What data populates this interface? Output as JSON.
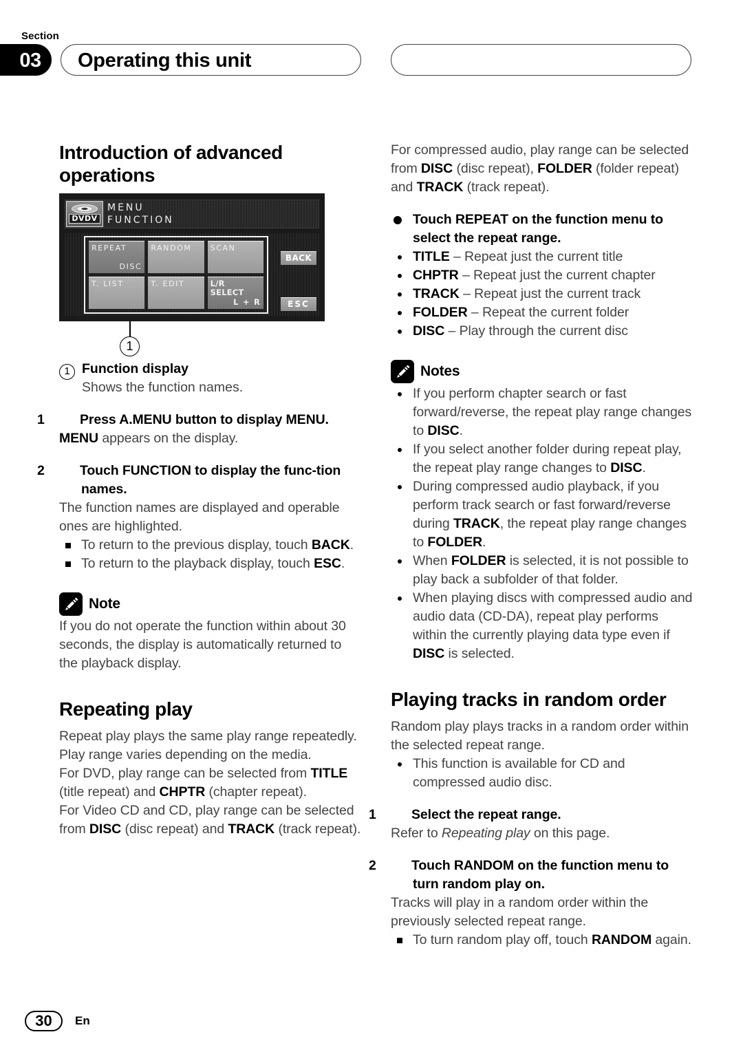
{
  "header": {
    "section_label": "Section",
    "section_number": "03",
    "title": "Operating this unit"
  },
  "footer": {
    "page_number": "30",
    "language": "En"
  },
  "left_column": {
    "heading": "Introduction of advanced operations",
    "lcd": {
      "badge_text": "DVDV",
      "topline1": "MENU",
      "topline2": "FUNCTION",
      "buttons": [
        {
          "label": "REPEAT",
          "sub": "DISC",
          "active": true
        },
        {
          "label": "RANDOM",
          "sub": "",
          "active": false
        },
        {
          "label": "SCAN",
          "sub": "",
          "active": false
        },
        {
          "label": "T. LIST",
          "sub": "",
          "active": false
        },
        {
          "label": "T. EDIT",
          "sub": "",
          "active": false
        },
        {
          "label": "L/R SELECT",
          "sub": "L + R",
          "active": true
        }
      ],
      "side_buttons": [
        "BACK",
        "ESC"
      ],
      "callout": "1"
    },
    "legend": {
      "marker": "1",
      "label": "Function display",
      "description": "Shows the function names."
    },
    "step1": {
      "number": "1",
      "title": "Press A.MENU button to display MENU.",
      "body_bold": "MENU",
      "body_rest": " appears on the display."
    },
    "step2": {
      "number": "2",
      "title": "Touch FUNCTION to display the func-tion names.",
      "body": "The function names are displayed and operable ones are highlighted.",
      "bullets": [
        {
          "pre": "To return to the previous display, touch ",
          "bold": "BACK",
          "post": "."
        },
        {
          "pre": "To return to the playback display, touch ",
          "bold": "ESC",
          "post": "."
        }
      ]
    },
    "note": {
      "title": "Note",
      "icon": "pencil-icon",
      "body": "If you do not operate the function within about 30 seconds, the display is automatically returned to the playback display."
    },
    "repeating_play": {
      "heading": "Repeating play",
      "para1": "Repeat play plays the same play range repeatedly. Play range varies depending on the media.",
      "para2_a": "For DVD, play range can be selected from ",
      "para2_b1": "TITLE",
      "para2_c": " (title repeat) and ",
      "para2_b2": "CHPTR",
      "para2_d": " (chapter repeat).",
      "para3_a": "For Video CD and CD, play range can be selected from ",
      "para3_b1": "DISC",
      "para3_c": " (disc repeat) and ",
      "para3_b2": "TRACK",
      "para3_d": " (track repeat)."
    }
  },
  "right_column": {
    "para_top": {
      "a": "For compressed audio, play range can be selected from ",
      "b1": "DISC",
      "c": " (disc repeat), ",
      "b2": "FOLDER",
      "d": " (folder repeat) and ",
      "b3": "TRACK",
      "e": " (track repeat)."
    },
    "touch_repeat_heading": "Touch REPEAT on the function menu to select the repeat range.",
    "repeat_options": [
      {
        "term": "TITLE",
        "desc": " – Repeat just the current title"
      },
      {
        "term": "CHPTR",
        "desc": " – Repeat just the current chapter"
      },
      {
        "term": "TRACK",
        "desc": " – Repeat just the current track"
      },
      {
        "term": "FOLDER",
        "desc": " – Repeat the current folder"
      },
      {
        "term": "DISC",
        "desc": " – Play through the current disc"
      }
    ],
    "notes": {
      "title": "Notes",
      "icon": "pencil-icon",
      "items": [
        {
          "a": "If you perform chapter search or fast forward/reverse, the repeat play range changes to ",
          "b": "DISC",
          "c": "."
        },
        {
          "a": "If you select another folder during repeat play, the repeat play range changes to ",
          "b": "DISC",
          "c": "."
        },
        {
          "a": "During compressed audio playback, if you perform track search or fast forward/reverse during ",
          "b": "TRACK",
          "c": ", the repeat play range changes to ",
          "b2": "FOLDER",
          "d": "."
        },
        {
          "a": "When ",
          "b": "FOLDER",
          "c": " is selected, it is not possible to play back a subfolder of that folder."
        },
        {
          "a": "When playing discs with compressed audio and audio data (CD-DA), repeat play performs within the currently playing data type even if ",
          "b": "DISC",
          "c": " is selected."
        }
      ]
    },
    "random": {
      "heading": "Playing tracks in random order",
      "intro": "Random play plays tracks in a random order within the selected repeat range.",
      "bullet": "This function is available for CD and compressed audio disc.",
      "step1": {
        "number": "1",
        "title": "Select the repeat range.",
        "body_pre": "Refer to ",
        "body_italic": "Repeating play",
        "body_post": " on this page."
      },
      "step2": {
        "number": "2",
        "title": "Touch RANDOM on the function menu to turn random play on.",
        "body": "Tracks will play in a random order within the previously selected repeat range.",
        "bullet_pre": "To turn random play off, touch ",
        "bullet_bold": "RANDOM",
        "bullet_post": " again."
      }
    }
  }
}
